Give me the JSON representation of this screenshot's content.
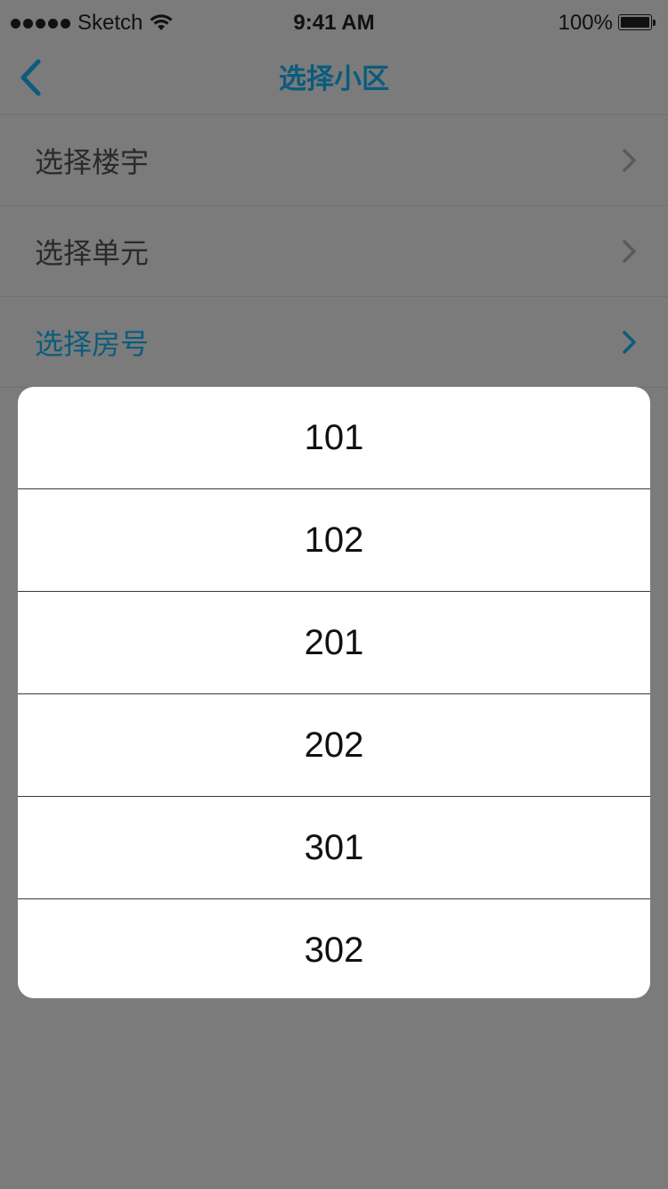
{
  "status_bar": {
    "carrier": "Sketch",
    "time": "9:41 AM",
    "battery": "100%"
  },
  "nav": {
    "title": "选择小区",
    "back_icon": "chevron-left-icon",
    "accent_color": "#0b5c7c"
  },
  "menu": {
    "items": [
      {
        "label": "选择楼宇",
        "active": false
      },
      {
        "label": "选择单元",
        "active": false
      },
      {
        "label": "选择房号",
        "active": true
      }
    ]
  },
  "picker": {
    "options": [
      "101",
      "102",
      "201",
      "202",
      "301",
      "302"
    ]
  }
}
